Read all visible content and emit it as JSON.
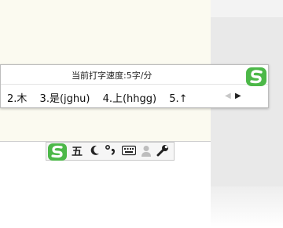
{
  "ime": {
    "speed_label": "当前打字速度:5字/分",
    "candidates": [
      "2.木",
      "3.是(jghu)",
      "4.上(hhgg)",
      "5.↑"
    ],
    "prev_arrow": "◀",
    "next_arrow": "▶"
  },
  "toolbar": {
    "mode_label": "五"
  },
  "icons": {
    "logo": "sogou-logo-icon",
    "moon": "half-width-moon-icon",
    "punct": "chinese-punctuation-icon",
    "keyboard": "soft-keyboard-icon",
    "user": "user-icon",
    "wrench": "settings-wrench-icon"
  },
  "colors": {
    "logo_green": "#4cb848",
    "document_bg": "#fbfaf0",
    "side_panel": "#e9e9e9"
  }
}
